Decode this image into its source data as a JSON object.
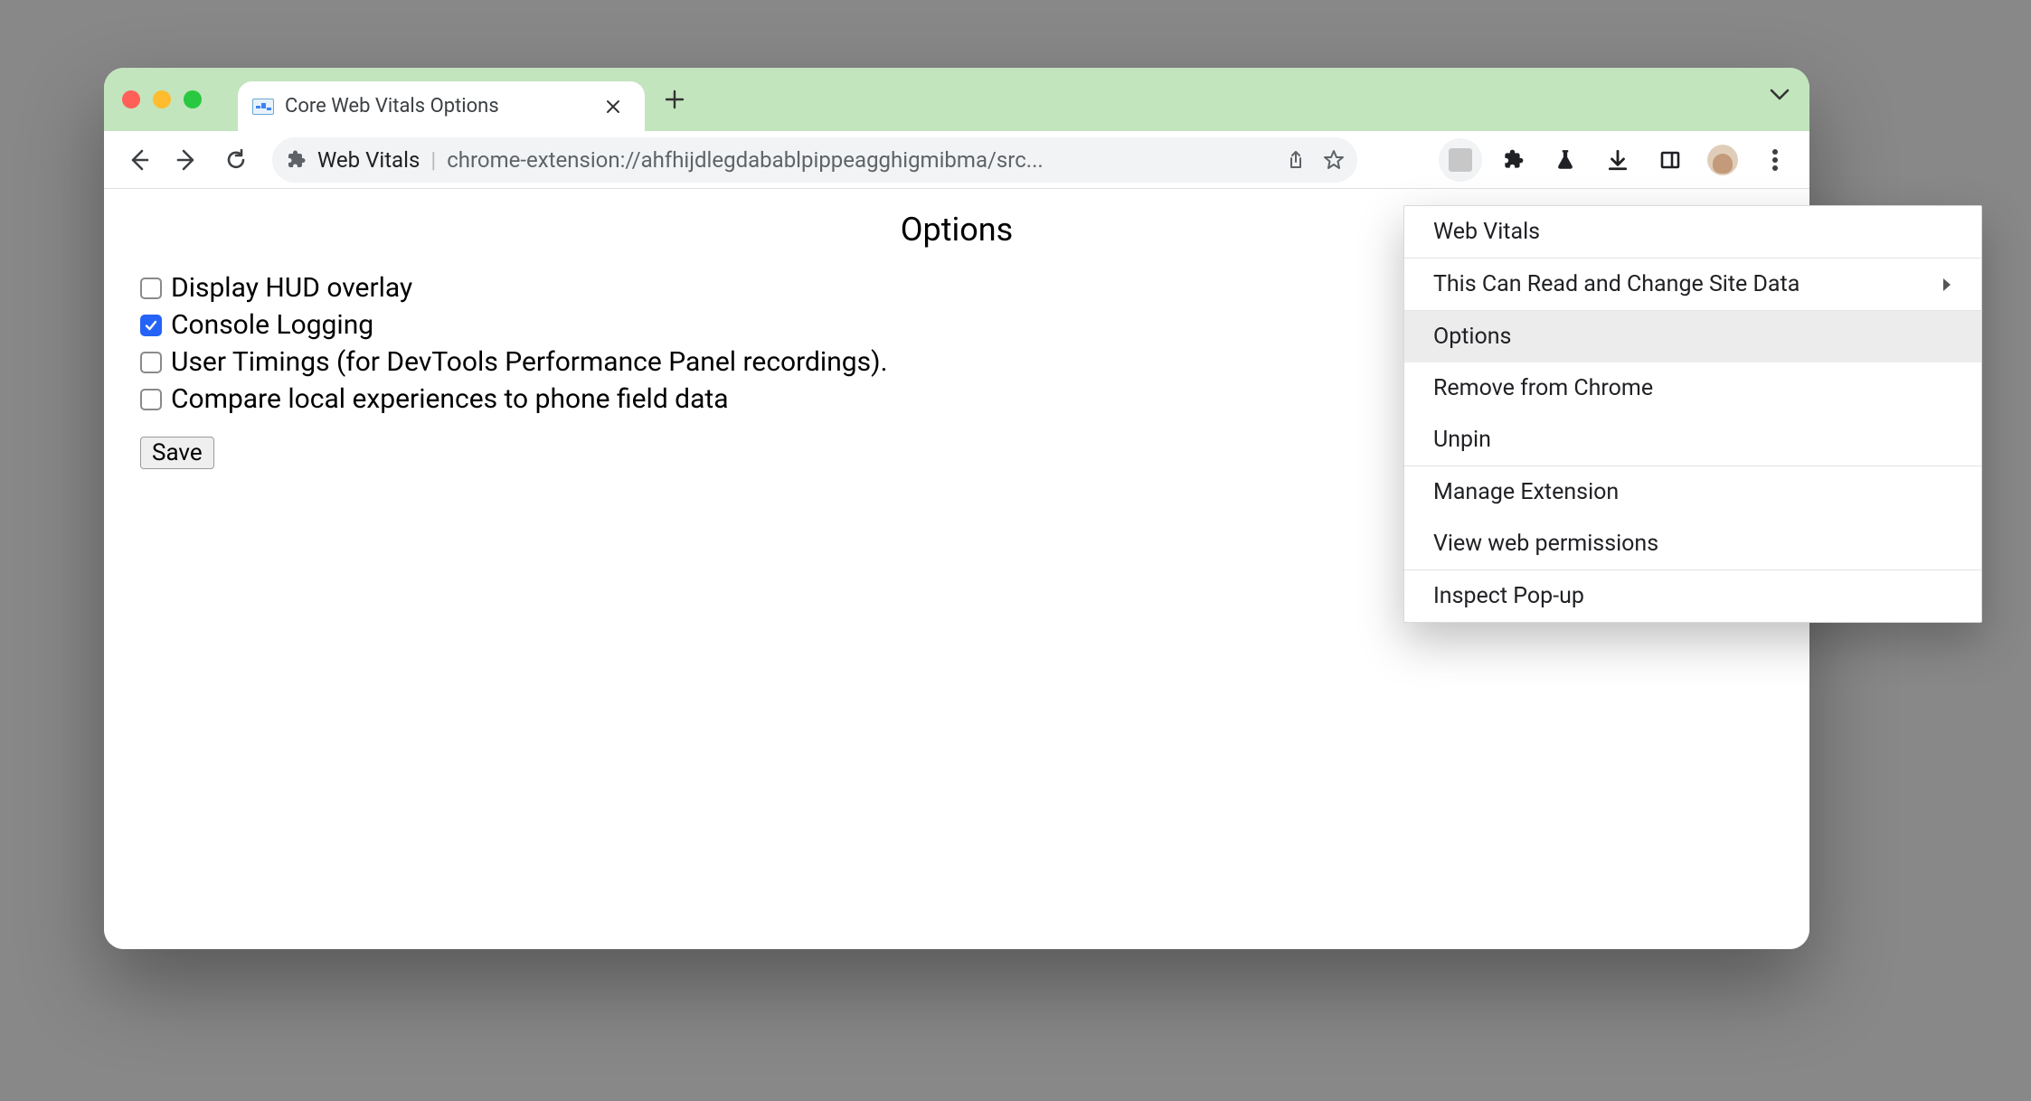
{
  "tab": {
    "title": "Core Web Vitals Options"
  },
  "omnibox": {
    "ext_name": "Web Vitals",
    "url": "chrome-extension://ahfhijdlegdabablpippeagghigmibma/src..."
  },
  "page": {
    "title": "Options",
    "options": [
      {
        "label": "Display HUD overlay",
        "checked": false
      },
      {
        "label": "Console Logging",
        "checked": true
      },
      {
        "label": "User Timings (for DevTools Performance Panel recordings).",
        "checked": false
      },
      {
        "label": "Compare local experiences to phone field data",
        "checked": false
      }
    ],
    "save_label": "Save"
  },
  "context_menu": {
    "header": "Web Vitals",
    "site_data": "This Can Read and Change Site Data",
    "items": [
      {
        "label": "Options",
        "hover": true
      },
      {
        "label": "Remove from Chrome"
      },
      {
        "label": "Unpin"
      }
    ],
    "group2": [
      {
        "label": "Manage Extension"
      },
      {
        "label": "View web permissions"
      }
    ],
    "group3": [
      {
        "label": "Inspect Pop-up"
      }
    ]
  }
}
